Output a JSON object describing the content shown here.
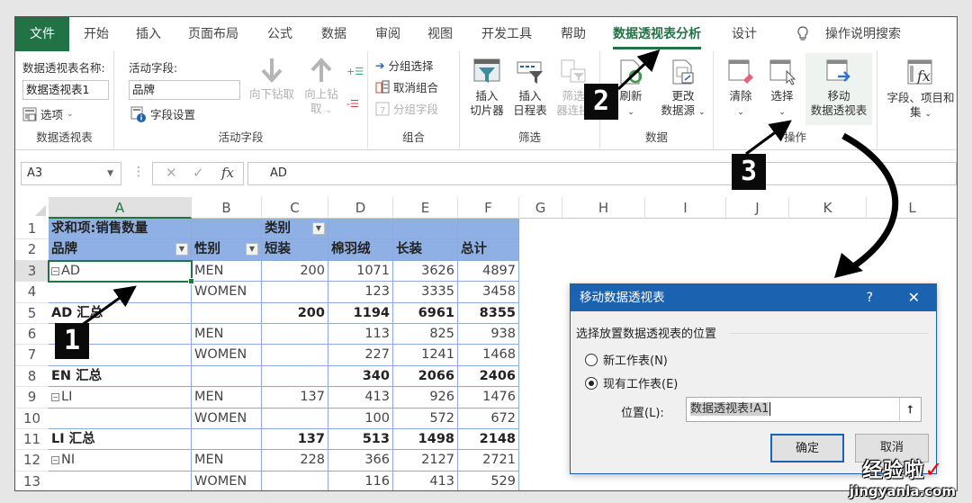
{
  "ribbon_tabs": [
    {
      "label": "文件",
      "type": "file"
    },
    {
      "label": "开始"
    },
    {
      "label": "插入"
    },
    {
      "label": "页面布局"
    },
    {
      "label": "公式"
    },
    {
      "label": "数据"
    },
    {
      "label": "审阅"
    },
    {
      "label": "视图"
    },
    {
      "label": "开发工具"
    },
    {
      "label": "帮助"
    },
    {
      "label": "数据透视表分析",
      "active": true
    },
    {
      "label": "设计"
    }
  ],
  "search_placeholder": "操作说明搜索",
  "ribbon": {
    "pivot_group": {
      "name_label": "数据透视表名称:",
      "name_value": "数据透视表1",
      "options_label": "选项",
      "group_label": "数据透视表"
    },
    "active_field_group": {
      "field_label": "活动字段:",
      "field_value": "品牌",
      "field_settings": "字段设置",
      "drill_down": "向下钻取",
      "drill_up_line1": "向上钻",
      "drill_up_line2": "取",
      "group_label": "活动字段"
    },
    "group_group": {
      "group_selection": "分组选择",
      "ungroup": "取消组合",
      "group_field": "分组字段",
      "group_label": "组合"
    },
    "filter_group": {
      "insert_slicer_1": "插入",
      "insert_slicer_2": "切片器",
      "insert_timeline_1": "插入",
      "insert_timeline_2": "日程表",
      "filter_conn_1": "筛选",
      "filter_conn_2": "器连接",
      "group_label": "筛选"
    },
    "data_group": {
      "refresh": "刷新",
      "change_source_1": "更改",
      "change_source_2": "数据源",
      "group_label": "数据"
    },
    "actions_group": {
      "clear": "清除",
      "select": "选择",
      "move_1": "移动",
      "move_2": "数据透视表",
      "group_label": "操作"
    },
    "calc_group": {
      "fields_items_1": "字段、项目和",
      "fields_items_2": "集"
    }
  },
  "formula_bar": {
    "name_box": "A3",
    "cancel": "✕",
    "enter": "✓",
    "fx": "fx",
    "value": "AD"
  },
  "columns": [
    "A",
    "B",
    "C",
    "D",
    "E",
    "F",
    "G",
    "H",
    "I",
    "J",
    "K",
    "L"
  ],
  "rows": [
    "1",
    "2",
    "3",
    "4",
    "5",
    "6",
    "7",
    "8",
    "9",
    "10",
    "11",
    "12",
    "13"
  ],
  "pivot": {
    "row1": {
      "a": "求和项:销售数量",
      "c": "类别"
    },
    "headers": [
      "品牌",
      "性别",
      "短装",
      "棉羽绒",
      "长装",
      "总计"
    ],
    "body": [
      {
        "brand": "AD",
        "collapse": true,
        "gender": "MEN",
        "c": "200",
        "d": "1071",
        "e": "3626",
        "f": "4897"
      },
      {
        "brand": "",
        "gender": "WOMEN",
        "c": "",
        "d": "123",
        "e": "3335",
        "f": "3458"
      },
      {
        "brand": "AD 汇总",
        "subtotal": true,
        "gender": "",
        "c": "200",
        "d": "1194",
        "e": "6961",
        "f": "8355"
      },
      {
        "brand": "",
        "gender": "MEN",
        "c": "",
        "d": "113",
        "e": "825",
        "f": "938"
      },
      {
        "brand": "",
        "gender": "WOMEN",
        "c": "",
        "d": "227",
        "e": "1241",
        "f": "1468"
      },
      {
        "brand": "EN 汇总",
        "subtotal": true,
        "gender": "",
        "c": "",
        "d": "340",
        "e": "2066",
        "f": "2406"
      },
      {
        "brand": "LI",
        "collapse": true,
        "gender": "MEN",
        "c": "137",
        "d": "413",
        "e": "926",
        "f": "1476"
      },
      {
        "brand": "",
        "gender": "WOMEN",
        "c": "",
        "d": "100",
        "e": "572",
        "f": "672"
      },
      {
        "brand": "LI 汇总",
        "subtotal": true,
        "gender": "",
        "c": "137",
        "d": "513",
        "e": "1498",
        "f": "2148"
      },
      {
        "brand": "NI",
        "collapse": true,
        "gender": "MEN",
        "c": "228",
        "d": "366",
        "e": "2127",
        "f": "2721"
      },
      {
        "brand": "",
        "gender": "WOMEN",
        "c": "",
        "d": "116",
        "e": "413",
        "f": "529"
      }
    ]
  },
  "dialog": {
    "title": "移动数据透视表",
    "help": "?",
    "close": "✕",
    "section": "选择放置数据透视表的位置",
    "option_new": "新工作表(N)",
    "option_existing": "现有工作表(E)",
    "selected_option": "existing",
    "location_label": "位置(L):",
    "location_value": "数据透视表!A1",
    "ok": "确定",
    "cancel": "取消"
  },
  "annotations": {
    "marker1": "1",
    "marker2": "2",
    "marker3": "3"
  },
  "watermark": {
    "cn": "经验啦",
    "check": "✓",
    "en": "jingyanla.com"
  }
}
